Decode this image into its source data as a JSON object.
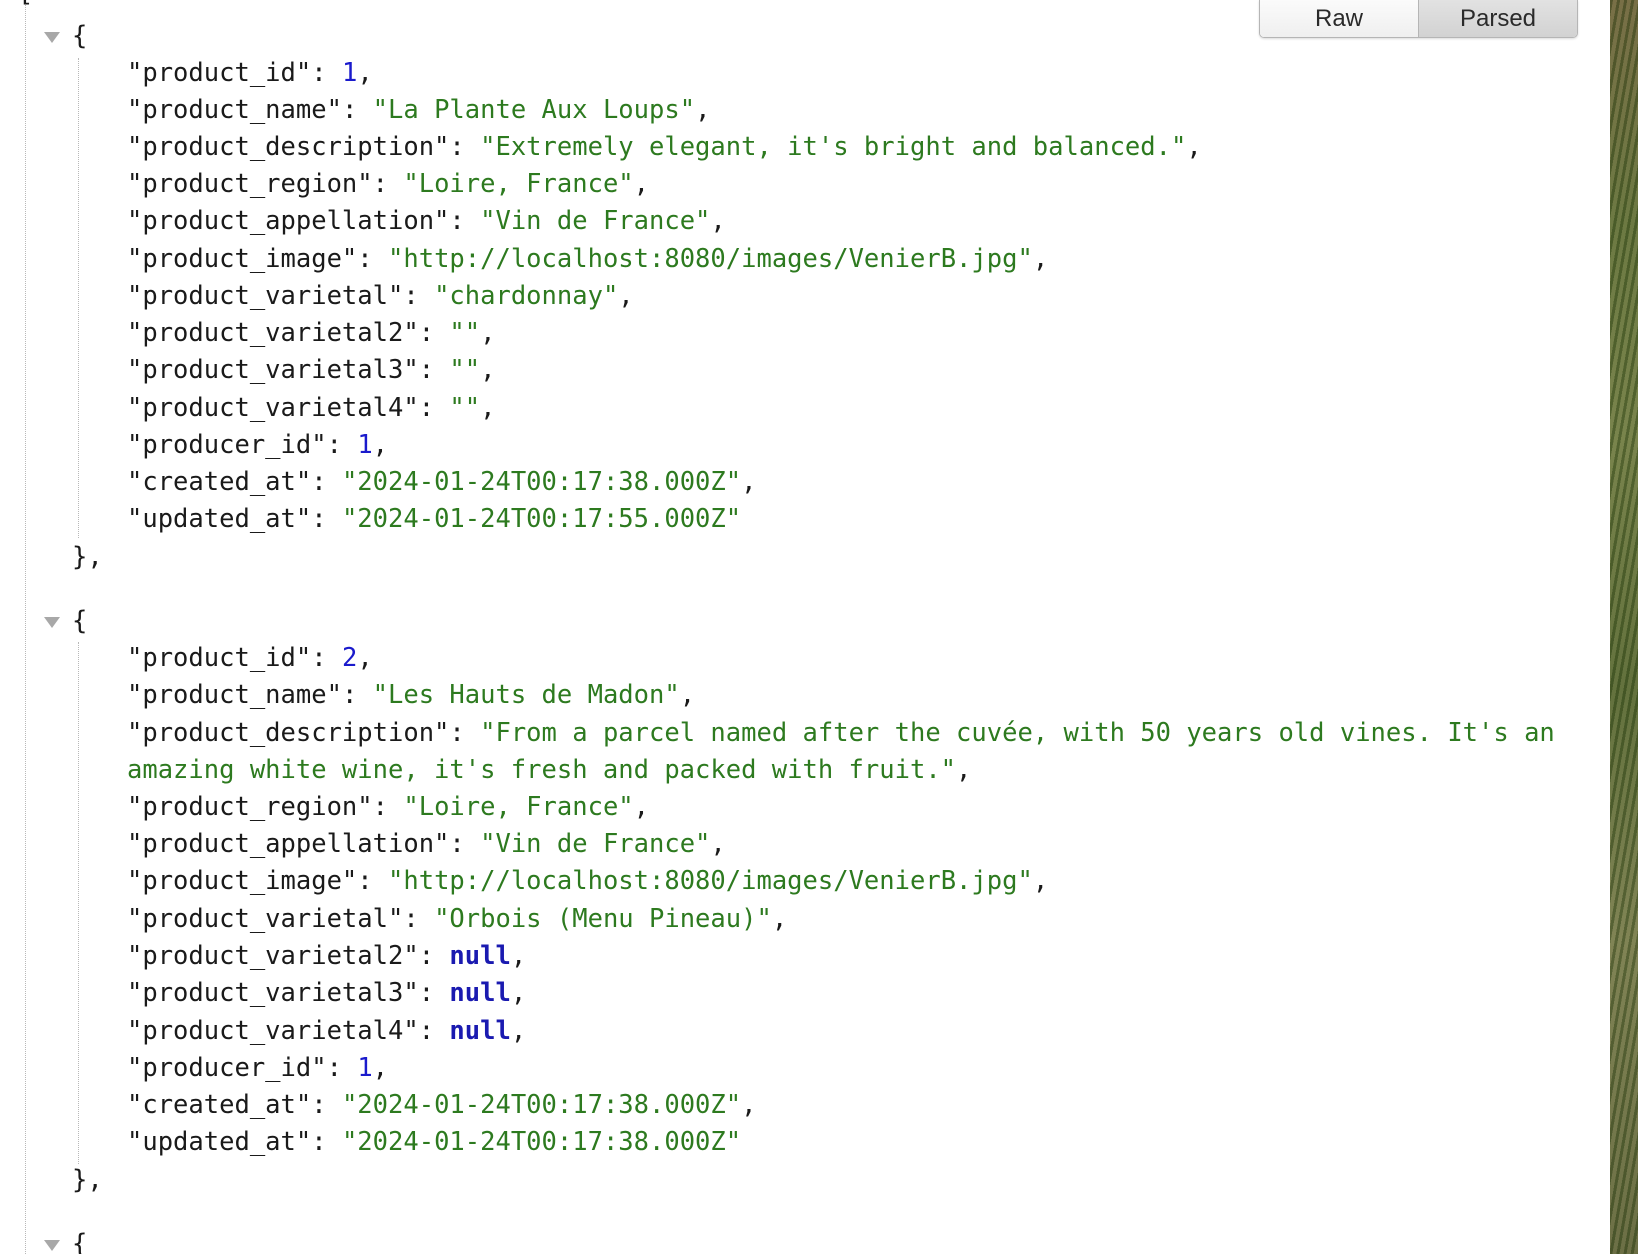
{
  "tabs": {
    "raw_label": "Raw",
    "parsed_label": "Parsed",
    "active": "Parsed"
  },
  "root_bracket": "[",
  "products": [
    {
      "product_id": "1",
      "product_name": "\"La Plante Aux Loups\"",
      "product_description": "\"Extremely elegant, it's bright and balanced.\"",
      "product_region": "\"Loire, France\"",
      "product_appellation": "\"Vin de France\"",
      "product_image": "\"http://localhost:8080/images/VenierB.jpg\"",
      "product_varietal": "\"chardonnay\"",
      "product_varietal2": "\"\"",
      "product_varietal3": "\"\"",
      "product_varietal4": "\"\"",
      "producer_id": "1",
      "created_at": "\"2024-01-24T00:17:38.000Z\"",
      "updated_at": "\"2024-01-24T00:17:55.000Z\""
    },
    {
      "product_id": "2",
      "product_name": "\"Les Hauts de Madon\"",
      "product_description_line1": "\"From a parcel named after the cuvée, with 50 years old vines. It's an",
      "product_description_line2": "amazing white wine, it's fresh and packed with fruit.\"",
      "product_region": "\"Loire, France\"",
      "product_appellation": "\"Vin de France\"",
      "product_image": "\"http://localhost:8080/images/VenierB.jpg\"",
      "product_varietal": "\"Orbois (Menu Pineau)\"",
      "product_varietal2": "null",
      "product_varietal3": "null",
      "product_varietal4": "null",
      "producer_id": "1",
      "created_at": "\"2024-01-24T00:17:38.000Z\"",
      "updated_at": "\"2024-01-24T00:17:38.000Z\""
    }
  ],
  "keys": {
    "product_id": "\"product_id\"",
    "product_name": "\"product_name\"",
    "product_description": "\"product_description\"",
    "product_region": "\"product_region\"",
    "product_appellation": "\"product_appellation\"",
    "product_image": "\"product_image\"",
    "product_varietal": "\"product_varietal\"",
    "product_varietal2": "\"product_varietal2\"",
    "product_varietal3": "\"product_varietal3\"",
    "product_varietal4": "\"product_varietal4\"",
    "producer_id": "\"producer_id\"",
    "created_at": "\"created_at\"",
    "updated_at": "\"updated_at\""
  },
  "punct": {
    "open": "{",
    "close": "},",
    "sep": ": ",
    "comma": ","
  },
  "colors": {
    "string": "#2d7a1f",
    "number": "#1a1acc",
    "null": "#1a1ab0",
    "key": "#1a1a1a"
  }
}
